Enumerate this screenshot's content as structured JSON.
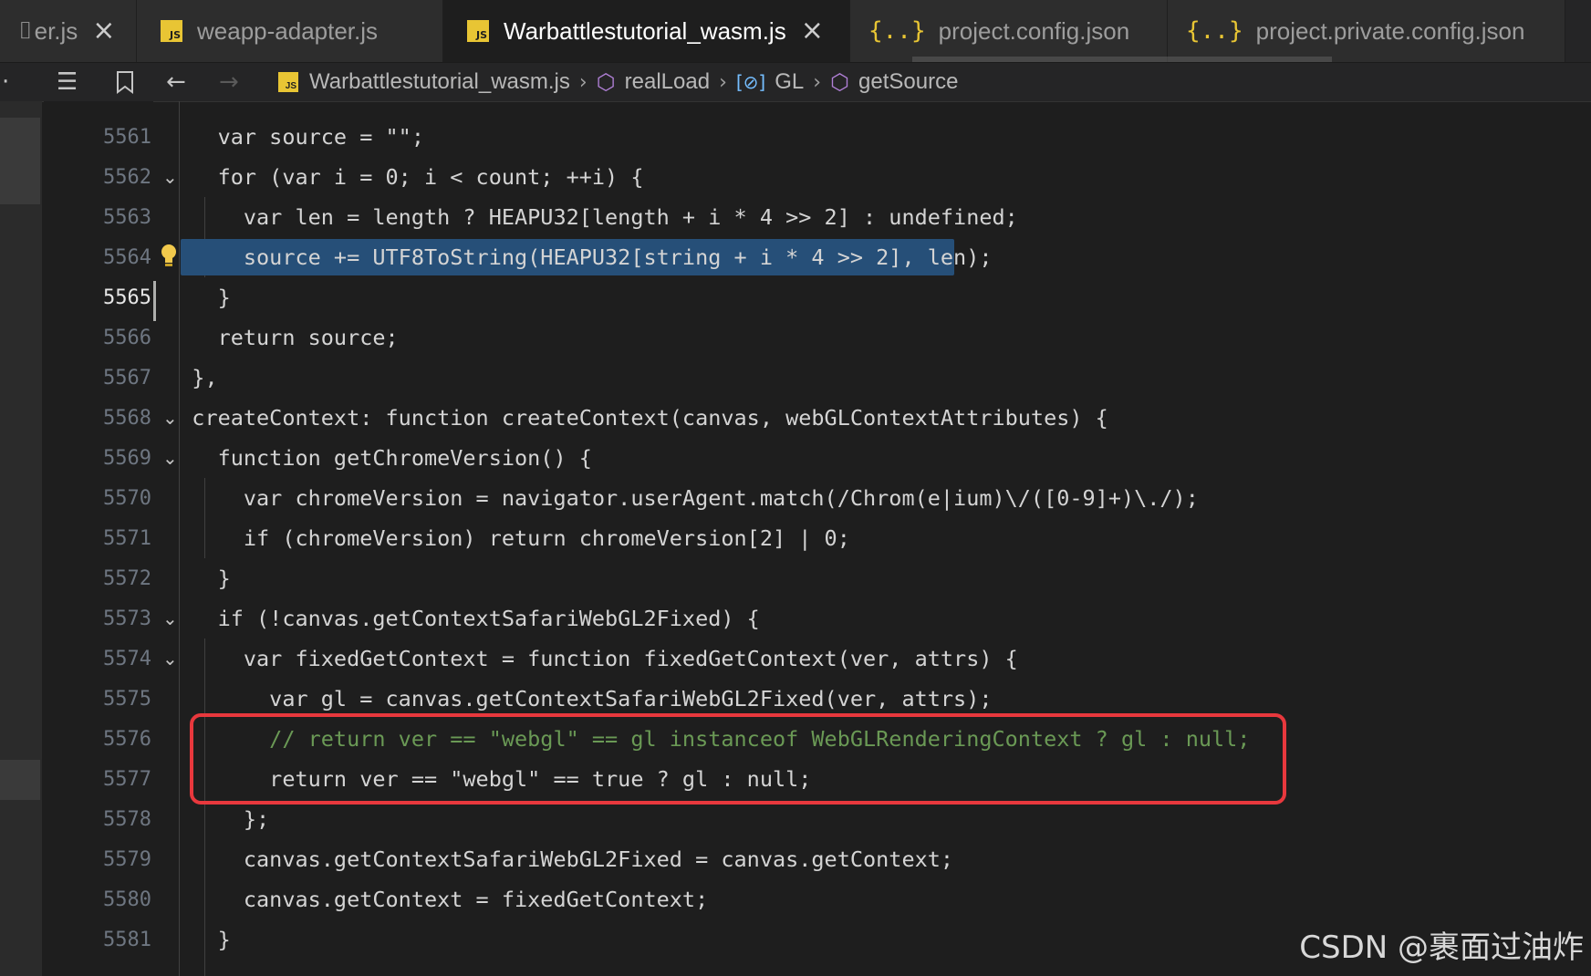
{
  "tabs": [
    {
      "label": "er.js",
      "type": "js",
      "active": false
    },
    {
      "label": "weapp-adapter.js",
      "type": "js",
      "active": false
    },
    {
      "label": "Warbattlestutorial_wasm.js",
      "type": "js",
      "active": true
    },
    {
      "label": "project.config.json",
      "type": "json",
      "active": false
    },
    {
      "label": "project.private.config.json",
      "type": "json",
      "active": false
    }
  ],
  "breadcrumb": {
    "file": "Warbattlestutorial_wasm.js",
    "items": [
      "realLoad",
      "GL",
      "getSource"
    ]
  },
  "code_lines": [
    {
      "num": "5561",
      "text": "    var source = \"\";"
    },
    {
      "num": "5562",
      "text": "    for (var i = 0; i < count; ++i) {"
    },
    {
      "num": "5563",
      "text": "      var len = length ? HEAPU32[length + i * 4 >> 2] : undefined;"
    },
    {
      "num": "5564",
      "text": "      source += UTF8ToString(HEAPU32[string + i * 4 >> 2], len);"
    },
    {
      "num": "5565",
      "text": "    }"
    },
    {
      "num": "5566",
      "text": "    return source;"
    },
    {
      "num": "5567",
      "text": "  },"
    },
    {
      "num": "5568",
      "text": "  createContext: function createContext(canvas, webGLContextAttributes) {"
    },
    {
      "num": "5569",
      "text": "    function getChromeVersion() {"
    },
    {
      "num": "5570",
      "text": "      var chromeVersion = navigator.userAgent.match(/Chrom(e|ium)\\/([0-9]+)\\./);"
    },
    {
      "num": "5571",
      "text": "      if (chromeVersion) return chromeVersion[2] | 0;"
    },
    {
      "num": "5572",
      "text": "    }"
    },
    {
      "num": "5573",
      "text": "    if (!canvas.getContextSafariWebGL2Fixed) {"
    },
    {
      "num": "5574",
      "text": "      var fixedGetContext = function fixedGetContext(ver, attrs) {"
    },
    {
      "num": "5575",
      "text": "        var gl = canvas.getContextSafariWebGL2Fixed(ver, attrs);"
    },
    {
      "num": "5576",
      "text": "        // return ver == \"webgl\" == gl instanceof WebGLRenderingContext ? gl : null;"
    },
    {
      "num": "5577",
      "text": "        return ver == \"webgl\" == true ? gl : null;"
    },
    {
      "num": "5578",
      "text": "      };"
    },
    {
      "num": "5579",
      "text": "      canvas.getContextSafariWebGL2Fixed = canvas.getContext;"
    },
    {
      "num": "5580",
      "text": "      canvas.getContext = fixedGetContext;"
    },
    {
      "num": "5581",
      "text": "    }"
    }
  ],
  "current_line": "5565",
  "selected_line": "5564",
  "watermark": "CSDN @裹面过油炸",
  "colors": {
    "background": "#1e1e1e",
    "selection": "#264f78",
    "annotation_box": "#e8383d"
  }
}
